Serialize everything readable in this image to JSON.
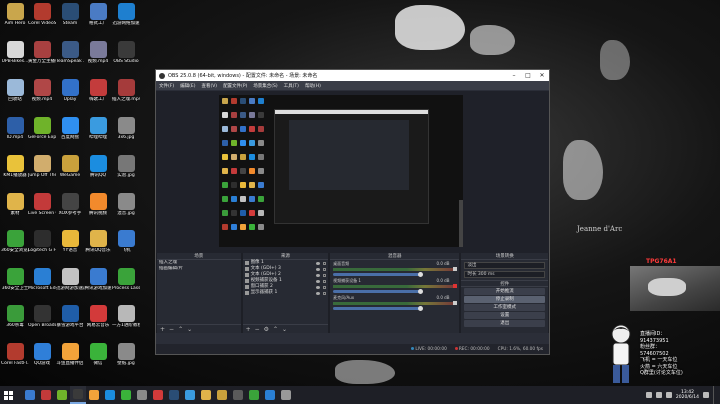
{
  "desktop_icons": [
    {
      "label": "Aim Hero",
      "color": "#c9a64c"
    },
    {
      "label": "Corel VideoStud...",
      "color": "#b33b2e"
    },
    {
      "label": "Steam",
      "color": "#2a4d75"
    },
    {
      "label": "格式工厂",
      "color": "#4a7bc4"
    },
    {
      "label": "迅游网络加速",
      "color": "#1e7fcf"
    },
    {
      "label": "UPB-Bikes...",
      "color": "#d8d8d8"
    },
    {
      "label": "黄金万全主播视频.mp4",
      "color": "#a84040"
    },
    {
      "label": "TeamSpeak 3",
      "color": "#3b5a86"
    },
    {
      "label": "视频.mp4",
      "color": "#7a7a9a"
    },
    {
      "label": "OBS Studio",
      "color": "#3a3a3a"
    },
    {
      "label": "回收站",
      "color": "#9bb9d9"
    },
    {
      "label": "视频.mp4",
      "color": "#b04747"
    },
    {
      "label": "Uplay",
      "color": "#3271c9"
    },
    {
      "label": "嗨歌工厂",
      "color": "#c33c3c"
    },
    {
      "label": "插入之魂.mp4",
      "color": "#a53b3b"
    },
    {
      "label": "ID.mp4",
      "color": "#2d5fa8"
    },
    {
      "label": "GeForce Experience",
      "color": "#6fb32a"
    },
    {
      "label": "百度网盘",
      "color": "#2f8ff0"
    },
    {
      "label": "哔哩哔哩",
      "color": "#3a9be0"
    },
    {
      "label": "3x6.jpg",
      "color": "#8a8a8a"
    },
    {
      "label": "KM1播放器",
      "color": "#e9c23a"
    },
    {
      "label": "Jump Off The Bridge",
      "color": "#d1ad6d"
    },
    {
      "label": "WeGame",
      "color": "#c9a13c"
    },
    {
      "label": "腾讯QQ",
      "color": "#1b8de0"
    },
    {
      "label": "实验.jpg",
      "color": "#777777"
    },
    {
      "label": "素材",
      "color": "#e0b44a"
    },
    {
      "label": "Live Screen Capture",
      "color": "#c33a3a"
    },
    {
      "label": "XOX参考手",
      "color": "#444444"
    },
    {
      "label": "腾讯视频",
      "color": "#f28a2c"
    },
    {
      "label": "混音.jpg",
      "color": "#8a8a8a"
    },
    {
      "label": "360安全浏览器",
      "color": "#3aa33a"
    },
    {
      "label": "Logitech G HUB",
      "color": "#2d2d2d"
    },
    {
      "label": "YY语音",
      "color": "#e9b83a"
    },
    {
      "label": "腾讯QQ音乐",
      "color": "#e0b44a"
    },
    {
      "label": "飞机",
      "color": "#3a7bd0"
    },
    {
      "label": "360安全卫士",
      "color": "#3aa33a"
    },
    {
      "label": "Microsoft Edge",
      "color": "#2a7fd4"
    },
    {
      "label": "迅游网游加速器",
      "color": "#c2c2c2"
    },
    {
      "label": "腾讯游戏加速",
      "color": "#3a7bd0"
    },
    {
      "label": "Process Lasso",
      "color": "#3aa33a"
    },
    {
      "label": "360杀毒",
      "color": "#3a9b3a"
    },
    {
      "label": "Open Broadcast...",
      "color": "#333333"
    },
    {
      "label": "暴雪游戏平台",
      "color": "#1f5da8"
    },
    {
      "label": "网易云音乐",
      "color": "#d33a3a"
    },
    {
      "label": "一方1进阶教程",
      "color": "#b8b8b8"
    },
    {
      "label": "Corel FastFl...",
      "color": "#b33b2e"
    },
    {
      "label": "QQ游戏",
      "color": "#2f7fd9"
    },
    {
      "label": "斗鱼直播伴侣",
      "color": "#f2a33a"
    },
    {
      "label": "微信",
      "color": "#3ab33a"
    },
    {
      "label": "壁纸.jpg",
      "color": "#8a8a8a"
    }
  ],
  "wallpaper_caption": "Jeanne d'Arc",
  "obs": {
    "title": "OBS 25.0.8 (64-bit, windows) - 配置文件: 未命名 - 场景: 未命名",
    "menu": [
      "文件(F)",
      "编辑(E)",
      "查看(V)",
      "配置文件(P)",
      "场景集合(S)",
      "工具(T)",
      "帮助(H)"
    ],
    "docks": {
      "scenes_title": "场景",
      "sources_title": "来源",
      "mixer_title": "混音器",
      "transitions_title": "场景转换",
      "controls_title": "控件"
    },
    "scenes": [
      "插入之魂",
      "插画编辑/片"
    ],
    "sources": [
      "图像 1",
      "文本 (GDI+) 3",
      "文本 (GDI+) 2",
      "视频捕获设备 1",
      "窗口捕获 2",
      "显示器捕获 1"
    ],
    "mixer": [
      {
        "name": "桌面音频",
        "db": "0.0 dB",
        "muted": false
      },
      {
        "name": "视频捕获设备 1",
        "db": "0.0 dB",
        "muted": true
      },
      {
        "name": "麦克风/Aux",
        "db": "0.0 dB",
        "muted": false
      }
    ],
    "transition": {
      "type": "淡出",
      "duration_label": "时长",
      "duration": "300 ms"
    },
    "controls": [
      "开始推流",
      "停止录制",
      "工作室模式",
      "设置",
      "退出"
    ],
    "status": {
      "live": "LIVE: 00:00:00",
      "rec": "REC: 00:00:00",
      "cpu": "CPU: 1.6%, 60.00 fps"
    }
  },
  "stream_overlay": {
    "label": "TPG76A1",
    "lines": [
      "直播间ID：",
      "914373951",
      "粉丝群：",
      "574607502",
      "飞机 = 一天车位",
      "火箭 = 六天车位",
      "Q群里(讨论文车位)"
    ]
  },
  "taskbar": {
    "apps": [
      "#3a7bd0",
      "#c33a3a",
      "#6fb32a",
      "#3a3a3a",
      "#f2a33a",
      "#1b8de0",
      "#3ab33a",
      "#8a8a8a",
      "#d33a3a",
      "#2a4d75",
      "#3a9be0",
      "#e0b44a",
      "#c9a13c",
      "#5a5a5a",
      "#3aa33a",
      "#2a7fd4",
      "#999999"
    ],
    "time": "13:42",
    "date": "2020/6/14"
  }
}
